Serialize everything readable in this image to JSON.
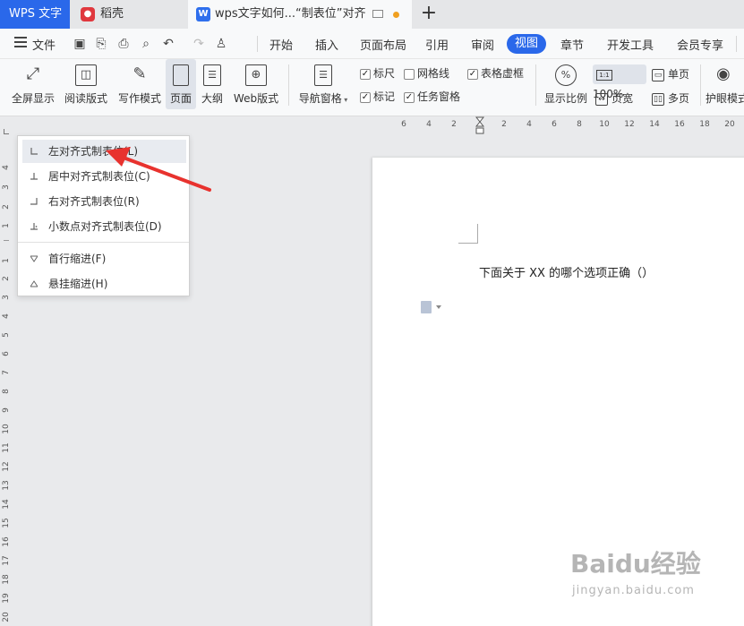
{
  "titlebar": {
    "app_tab": "WPS 文字",
    "tab2": "稻壳",
    "doc_tab": "wps文字如何...“制表位”对齐",
    "new_tab": "+"
  },
  "menu": {
    "file": "文件",
    "tabs": [
      "开始",
      "插入",
      "页面布局",
      "引用",
      "审阅",
      "视图",
      "章节",
      "开发工具",
      "会员专享"
    ],
    "active_tab": "视图"
  },
  "ribbon": {
    "buttons": [
      "全屏显示",
      "阅读版式",
      "写作模式",
      "页面",
      "大纲",
      "Web版式",
      "导航窗格"
    ],
    "selected": "页面",
    "checkboxes": [
      {
        "label": "标尺",
        "checked": true
      },
      {
        "label": "网格线",
        "checked": false
      },
      {
        "label": "表格虚框",
        "checked": true
      },
      {
        "label": "标记",
        "checked": true
      },
      {
        "label": "任务窗格",
        "checked": true
      }
    ],
    "zoom_btn": "显示比例",
    "zoom_value": "100%",
    "page_width": "页宽",
    "single_page": "单页",
    "multi_page": "多页",
    "eye_care": "护眼模式"
  },
  "ruler": {
    "h_ticks": [
      "6",
      "4",
      "2",
      "2",
      "4",
      "6",
      "8",
      "10",
      "12",
      "14",
      "16",
      "18",
      "20"
    ],
    "v_ticks_top": [
      "4",
      "3",
      "2",
      "1"
    ],
    "v_ticks_bottom": [
      "1",
      "2",
      "3",
      "4",
      "5",
      "6",
      "7",
      "8",
      "9",
      "10",
      "11",
      "12",
      "13",
      "14",
      "15",
      "16",
      "17",
      "18",
      "19",
      "20"
    ]
  },
  "dropdown": {
    "items": [
      {
        "label": "左对齐式制表位(L)",
        "icon": "tab-left-icon"
      },
      {
        "label": "居中对齐式制表位(C)",
        "icon": "tab-center-icon"
      },
      {
        "label": "右对齐式制表位(R)",
        "icon": "tab-right-icon"
      },
      {
        "label": "小数点对齐式制表位(D)",
        "icon": "tab-decimal-icon"
      },
      {
        "label": "首行缩进(F)",
        "icon": "first-line-indent-icon"
      },
      {
        "label": "悬挂缩进(H)",
        "icon": "hanging-indent-icon"
      }
    ]
  },
  "document": {
    "text": "下面关于 XX 的哪个选项正确（）"
  },
  "watermark": {
    "brand": "Baidu经验",
    "url": "jingyan.baidu.com"
  },
  "colors": {
    "accent": "#2a68ea",
    "arrow": "#e8322e"
  }
}
